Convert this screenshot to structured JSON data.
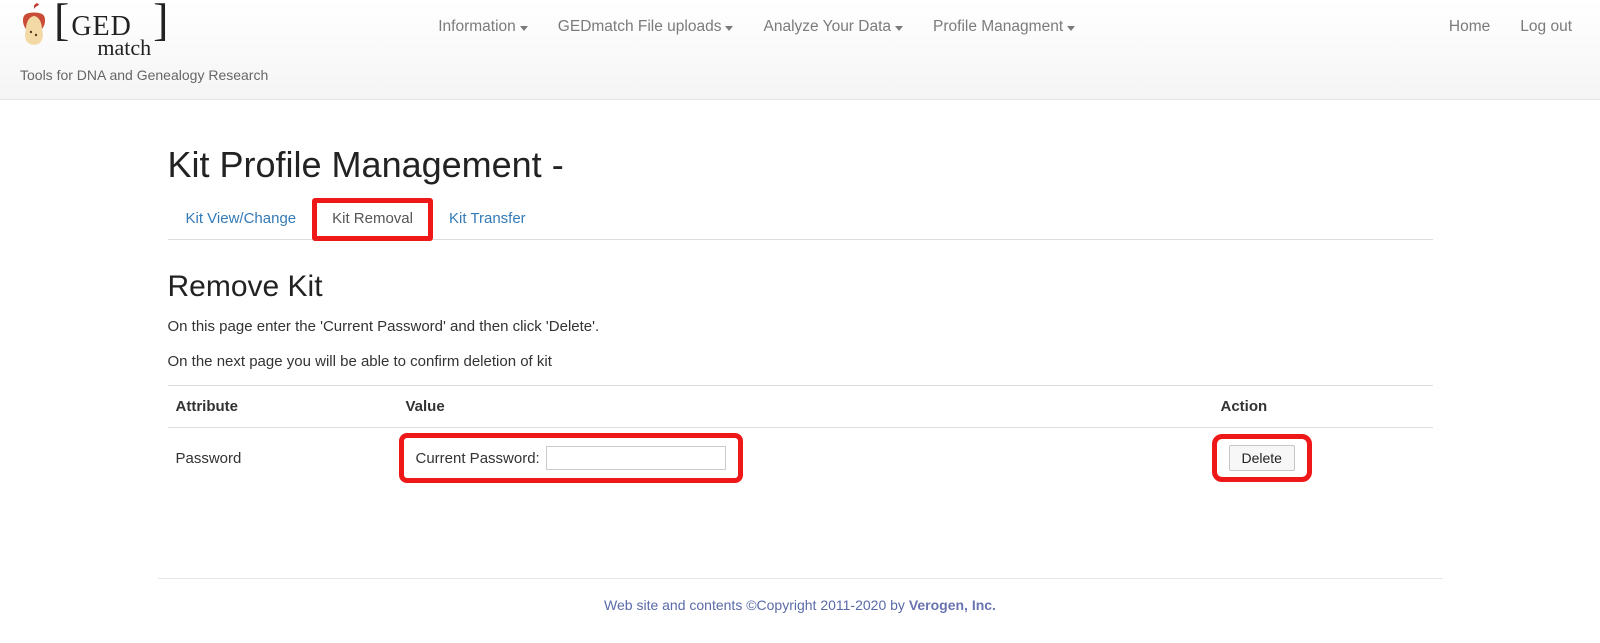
{
  "brand": {
    "top_line": "GED",
    "bottom_line": "match",
    "tagline": "Tools for DNA and Genealogy Research"
  },
  "nav": {
    "items": [
      {
        "label": "Information"
      },
      {
        "label": "GEDmatch File uploads"
      },
      {
        "label": "Analyze Your Data"
      },
      {
        "label": "Profile Managment"
      }
    ],
    "right": [
      {
        "label": "Home"
      },
      {
        "label": "Log out"
      }
    ]
  },
  "page": {
    "title": "Kit Profile Management -"
  },
  "tabs": [
    {
      "label": "Kit View/Change",
      "active": false
    },
    {
      "label": "Kit Removal",
      "active": true,
      "highlighted": true
    },
    {
      "label": "Kit Transfer",
      "active": false
    }
  ],
  "section": {
    "title": "Remove Kit",
    "intro1": "On this page enter the 'Current Password' and then click 'Delete'.",
    "intro2": "On the next page you will be able to confirm deletion of kit"
  },
  "table": {
    "headers": {
      "attribute": "Attribute",
      "value": "Value",
      "action": "Action"
    },
    "row": {
      "attribute": "Password",
      "value_label": "Current Password:",
      "value_input": "",
      "action_label": "Delete"
    }
  },
  "footer": {
    "prefix": "Web site and contents ©Copyright 2011-2020 by ",
    "owner": "Verogen, Inc."
  }
}
